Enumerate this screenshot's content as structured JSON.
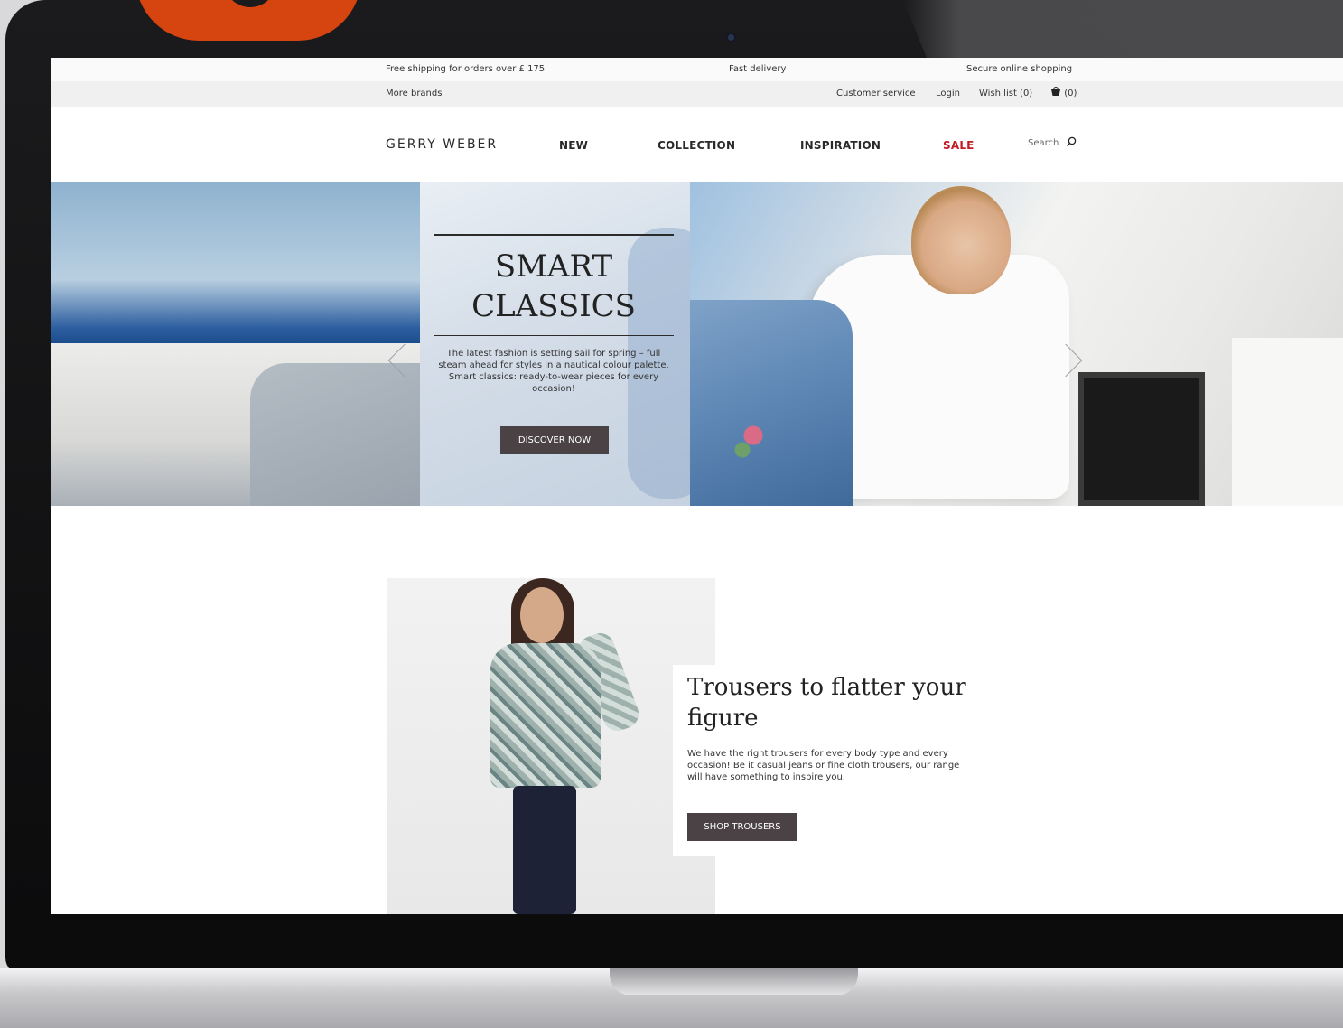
{
  "colors": {
    "sale": "#c41a25",
    "button": "#4a4245",
    "logo_blob": "#d6440f"
  },
  "topbar": {
    "shipping": "Free shipping for orders over £ 175",
    "delivery": "Fast delivery",
    "secure": "Secure online shopping"
  },
  "brandbar": {
    "more_brands": "More brands",
    "customer_service": "Customer service",
    "login": "Login",
    "wishlist": "Wish list (0)",
    "cart": "(0)"
  },
  "header": {
    "logo": "GERRY WEBER",
    "nav": [
      "NEW",
      "COLLECTION",
      "INSPIRATION",
      "SALE"
    ],
    "search": "Search"
  },
  "hero": {
    "title_line1": "SMART",
    "title_line2": "CLASSICS",
    "text": "The latest fashion is setting sail for spring – full steam ahead for styles in a nautical colour palette. Smart classics: ready-to-wear pieces for every occasion!",
    "button": "DISCOVER NOW"
  },
  "promo": {
    "title": "Trousers to flatter your figure",
    "text": "We have the right trousers for every body type and every occasion! Be it casual jeans or fine cloth trousers, our range will have something to inspire you.",
    "button": "SHOP TROUSERS"
  },
  "icons": [
    "search-icon",
    "cart-icon",
    "chevron-left-icon",
    "chevron-right-icon"
  ]
}
